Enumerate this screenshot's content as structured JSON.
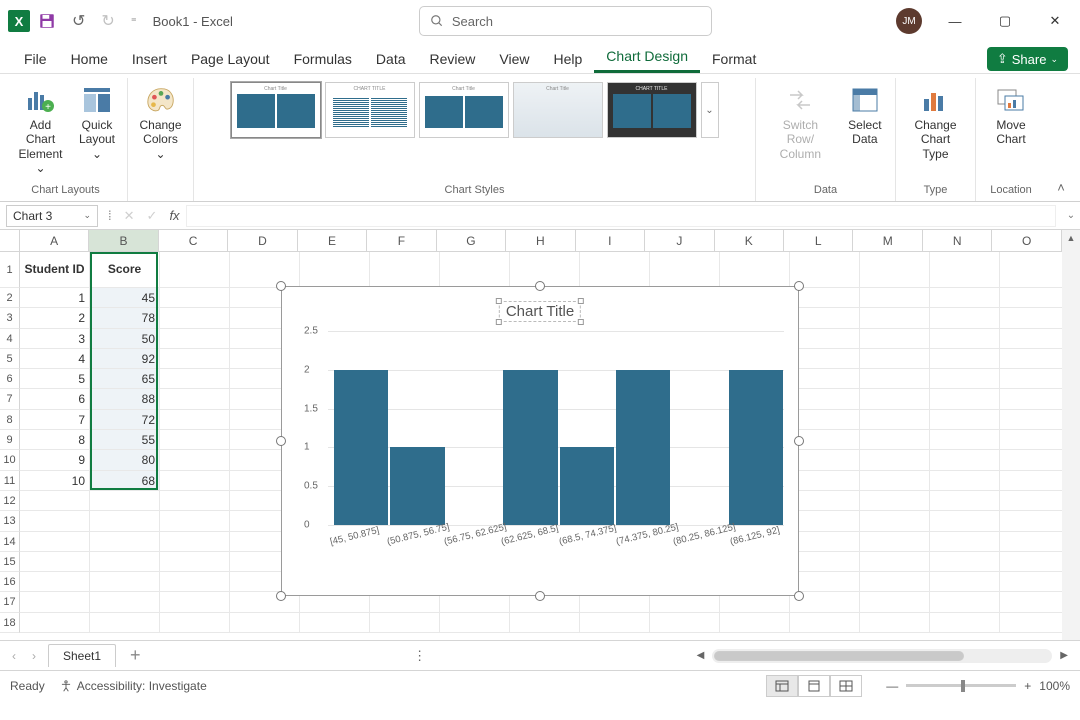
{
  "title": "Book1  -  Excel",
  "search_placeholder": "Search",
  "avatar": "JM",
  "tabs": {
    "file": "File",
    "home": "Home",
    "insert": "Insert",
    "page_layout": "Page Layout",
    "formulas": "Formulas",
    "data": "Data",
    "review": "Review",
    "view": "View",
    "help": "Help",
    "chart_design": "Chart Design",
    "format": "Format",
    "share": "Share"
  },
  "ribbon": {
    "chart_layouts": "Chart Layouts",
    "add_chart_element": "Add Chart Element ⌄",
    "quick_layout": "Quick Layout ⌄",
    "change_colors": "Change Colors ⌄",
    "chart_styles": "Chart Styles",
    "switch_row_col": "Switch Row/ Column",
    "select_data": "Select Data",
    "data": "Data",
    "change_chart_type": "Change Chart Type",
    "type": "Type",
    "move_chart": "Move Chart",
    "location": "Location"
  },
  "namebox": "Chart 3",
  "columns": [
    "A",
    "B",
    "C",
    "D",
    "E",
    "F",
    "G",
    "H",
    "I",
    "J",
    "K",
    "L",
    "M",
    "N",
    "O"
  ],
  "rows": [
    "1",
    "2",
    "3",
    "4",
    "5",
    "6",
    "7",
    "8",
    "9",
    "10",
    "11",
    "12",
    "13",
    "14",
    "15",
    "16",
    "17",
    "18"
  ],
  "table": {
    "headers": {
      "a": "Student ID",
      "b": "Score"
    },
    "data": [
      {
        "id": 1,
        "score": 45
      },
      {
        "id": 2,
        "score": 78
      },
      {
        "id": 3,
        "score": 50
      },
      {
        "id": 4,
        "score": 92
      },
      {
        "id": 5,
        "score": 65
      },
      {
        "id": 6,
        "score": 88
      },
      {
        "id": 7,
        "score": 72
      },
      {
        "id": 8,
        "score": 55
      },
      {
        "id": 9,
        "score": 80
      },
      {
        "id": 10,
        "score": 68
      }
    ]
  },
  "chart_data": {
    "type": "bar",
    "title": "Chart Title",
    "ylabel": "",
    "xlabel": "",
    "ylim": [
      0,
      2.5
    ],
    "yticks": [
      0,
      0.5,
      1,
      1.5,
      2,
      2.5
    ],
    "categories": [
      "[45, 50.875]",
      "(50.875, 56.75]",
      "(56.75, 62.625]",
      "(62.625, 68.5]",
      "(68.5, 74.375]",
      "(74.375, 80.25]",
      "(80.25, 86.125]",
      "(86.125, 92]"
    ],
    "values": [
      2,
      1,
      0,
      2,
      1,
      2,
      0,
      2
    ]
  },
  "sheet_tab": "Sheet1",
  "status": {
    "ready": "Ready",
    "accessibility": "Accessibility: Investigate",
    "zoom": "100%"
  }
}
